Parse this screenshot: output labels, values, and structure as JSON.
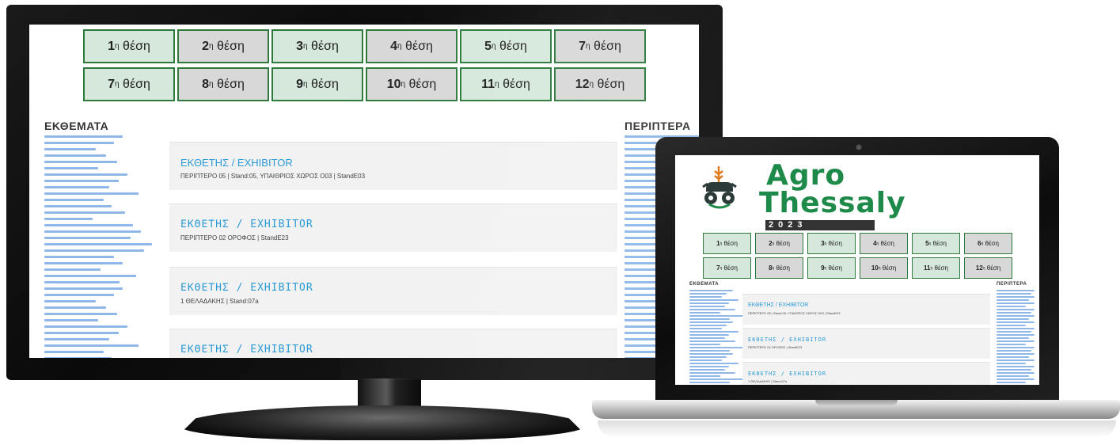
{
  "site": {
    "positions_row1": [
      {
        "num": "1",
        "sup": "η",
        "label": "θέση",
        "tone": "green"
      },
      {
        "num": "2",
        "sup": "η",
        "label": "θέση",
        "tone": "gray"
      },
      {
        "num": "3",
        "sup": "η",
        "label": "θέση",
        "tone": "green"
      },
      {
        "num": "4",
        "sup": "η",
        "label": "θέση",
        "tone": "gray"
      },
      {
        "num": "5",
        "sup": "η",
        "label": "θέση",
        "tone": "green"
      },
      {
        "num": "7",
        "sup": "η",
        "label": "θέση",
        "tone": "gray"
      }
    ],
    "positions_row2": [
      {
        "num": "7",
        "sup": "η",
        "label": "θέση",
        "tone": "green"
      },
      {
        "num": "8",
        "sup": "η",
        "label": "θέση",
        "tone": "gray"
      },
      {
        "num": "9",
        "sup": "η",
        "label": "θέση",
        "tone": "green"
      },
      {
        "num": "10",
        "sup": "η",
        "label": "θέση",
        "tone": "gray"
      },
      {
        "num": "11",
        "sup": "η",
        "label": "θέση",
        "tone": "green"
      },
      {
        "num": "12",
        "sup": "η",
        "label": "θέση",
        "tone": "gray"
      }
    ],
    "left_heading": "ΕΚΘΕΜΑΤΑ",
    "right_heading": "ΠΕΡΙΠΤΕΡΑ",
    "cards": [
      {
        "title": "ΕΚΘΕΤΗΣ / EXHIBITOR",
        "subtitle": "ΠΕΡΙΠΤΕΡΟ 05 | Stand:05, ΥΠΑΙΘΡΙΟΣ ΧΩΡΟΣ Ο03 | StandE03",
        "style": "sans"
      },
      {
        "title": "ΕΚΘΕΤΗΣ / EXHIBITOR",
        "subtitle": "ΠΕΡΙΠΤΕΡΟ 02 ΟΡΟΦΟΣ | StandE23",
        "style": "mono"
      },
      {
        "title": "ΕΚΘΕΤΗΣ / EXHIBITOR",
        "subtitle": "1 ΘΕΛΑΔΑΚΗΣ | Stand:07a",
        "style": "mono"
      },
      {
        "title": "ΕΚΘΕΤΗΣ / EXHIBITOR",
        "subtitle": "",
        "style": "mono"
      }
    ]
  },
  "laptop": {
    "logo": {
      "line1": "Agro",
      "line2": "Thessaly",
      "year": "2023"
    },
    "positions_row1": [
      {
        "num": "1",
        "sup": "η",
        "label": "θέση",
        "tone": "green"
      },
      {
        "num": "2",
        "sup": "η",
        "label": "θέση",
        "tone": "gray"
      },
      {
        "num": "3",
        "sup": "η",
        "label": "θέση",
        "tone": "green"
      },
      {
        "num": "4",
        "sup": "η",
        "label": "θέση",
        "tone": "gray"
      },
      {
        "num": "5",
        "sup": "η",
        "label": "θέση",
        "tone": "green"
      },
      {
        "num": "6",
        "sup": "η",
        "label": "θέση",
        "tone": "gray"
      }
    ],
    "positions_row2": [
      {
        "num": "7",
        "sup": "η",
        "label": "θέση",
        "tone": "green"
      },
      {
        "num": "8",
        "sup": "η",
        "label": "θέση",
        "tone": "gray"
      },
      {
        "num": "9",
        "sup": "η",
        "label": "θέση",
        "tone": "green"
      },
      {
        "num": "10",
        "sup": "η",
        "label": "θέση",
        "tone": "gray"
      },
      {
        "num": "11",
        "sup": "η",
        "label": "θέση",
        "tone": "green"
      },
      {
        "num": "12",
        "sup": "η",
        "label": "θέση",
        "tone": "gray"
      }
    ],
    "left_heading": "ΕΚΘΕΜΑΤΑ",
    "right_heading": "ΠΕΡΙΠΤΕΡΑ",
    "cards": [
      {
        "title": "ΕΚΘΕΤΗΣ / EXHIBITOR",
        "subtitle": "ΠΕΡΙΠΤΕΡΟ 05 | Stand:05, ΥΠΑΙΘΡΙΟΣ ΧΩΡΟΣ Ο03 | StandE03",
        "style": "sans"
      },
      {
        "title": "ΕΚΘΕΤΗΣ / EXHIBITOR",
        "subtitle": "ΠΕΡΙΠΤΕΡΟ 02 ΟΡΟΦΟΣ | StandE23",
        "style": "mono"
      },
      {
        "title": "ΕΚΘΕΤΗΣ / EXHIBITOR",
        "subtitle": "1 ΘΕΛΑΔΑΚΗΣ | Stand:07a",
        "style": "mono"
      }
    ]
  },
  "colors": {
    "brand_green": "#1e8a4a",
    "cell_border": "#2d7a3c",
    "cell_green": "#d6e8dc",
    "cell_gray": "#d8d8d8",
    "link_blue": "#2a9ad6"
  },
  "icons": {
    "logo": "tractor-wheat-icon"
  }
}
